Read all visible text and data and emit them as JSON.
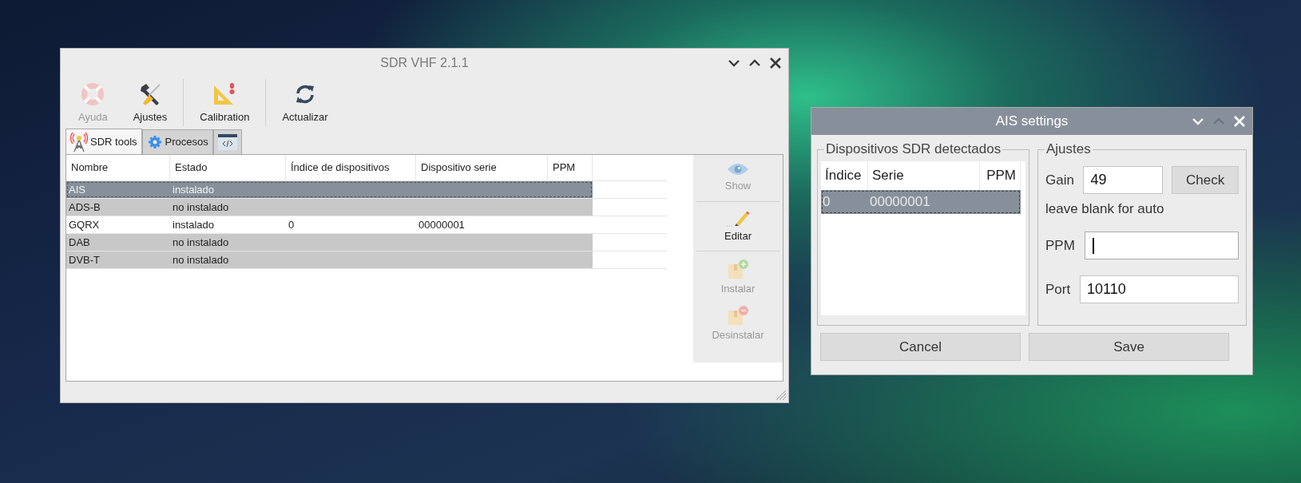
{
  "main_window": {
    "title": "SDR VHF 2.1.1",
    "toolbar": [
      {
        "label": "Ayuda",
        "disabled": true
      },
      {
        "label": "Ajustes",
        "disabled": false
      },
      {
        "label": "Calibration",
        "disabled": false
      },
      {
        "label": "Actualizar",
        "disabled": false
      }
    ],
    "tabs": [
      {
        "label": "SDR tools",
        "selected": true
      },
      {
        "label": "Procesos",
        "selected": false
      },
      {
        "selected": false
      }
    ],
    "table": {
      "columns": [
        "Nombre",
        "Estado",
        "Índice de dispositivos",
        "Dispositivo serie",
        "PPM"
      ],
      "rows": [
        {
          "cells": [
            "AIS",
            "instalado",
            "",
            "",
            ""
          ],
          "selected": true,
          "greyed": true
        },
        {
          "cells": [
            "ADS-B",
            "no instalado",
            "",
            "",
            ""
          ],
          "selected": false,
          "greyed": true
        },
        {
          "cells": [
            "GQRX",
            "instalado",
            "0",
            "00000001",
            ""
          ],
          "selected": false,
          "greyed": false
        },
        {
          "cells": [
            "DAB",
            "no instalado",
            "",
            "",
            ""
          ],
          "selected": false,
          "greyed": true
        },
        {
          "cells": [
            "DVB-T",
            "no instalado",
            "",
            "",
            ""
          ],
          "selected": false,
          "greyed": true
        }
      ]
    },
    "side_actions": [
      {
        "label": "Show",
        "disabled": true
      },
      {
        "label": "Editar",
        "disabled": false
      },
      {
        "label": "Instalar",
        "disabled": true
      },
      {
        "label": "Desinstalar",
        "disabled": true
      }
    ]
  },
  "ais_window": {
    "title": "AIS settings",
    "devices_group": {
      "title": "Dispositivos SDR detectados",
      "columns": [
        "Índice",
        "Serie",
        "PPM"
      ],
      "rows": [
        {
          "cells": [
            "0",
            "00000001",
            ""
          ],
          "selected": true
        }
      ]
    },
    "settings_group": {
      "title": "Ajustes",
      "gain": {
        "label": "Gain",
        "value": "49",
        "button": "Check",
        "hint": "leave blank for auto"
      },
      "ppm": {
        "label": "PPM",
        "focused": true
      },
      "port": {
        "label": "Port",
        "value": "10110"
      }
    },
    "buttons": [
      "Cancel",
      "Save"
    ]
  }
}
